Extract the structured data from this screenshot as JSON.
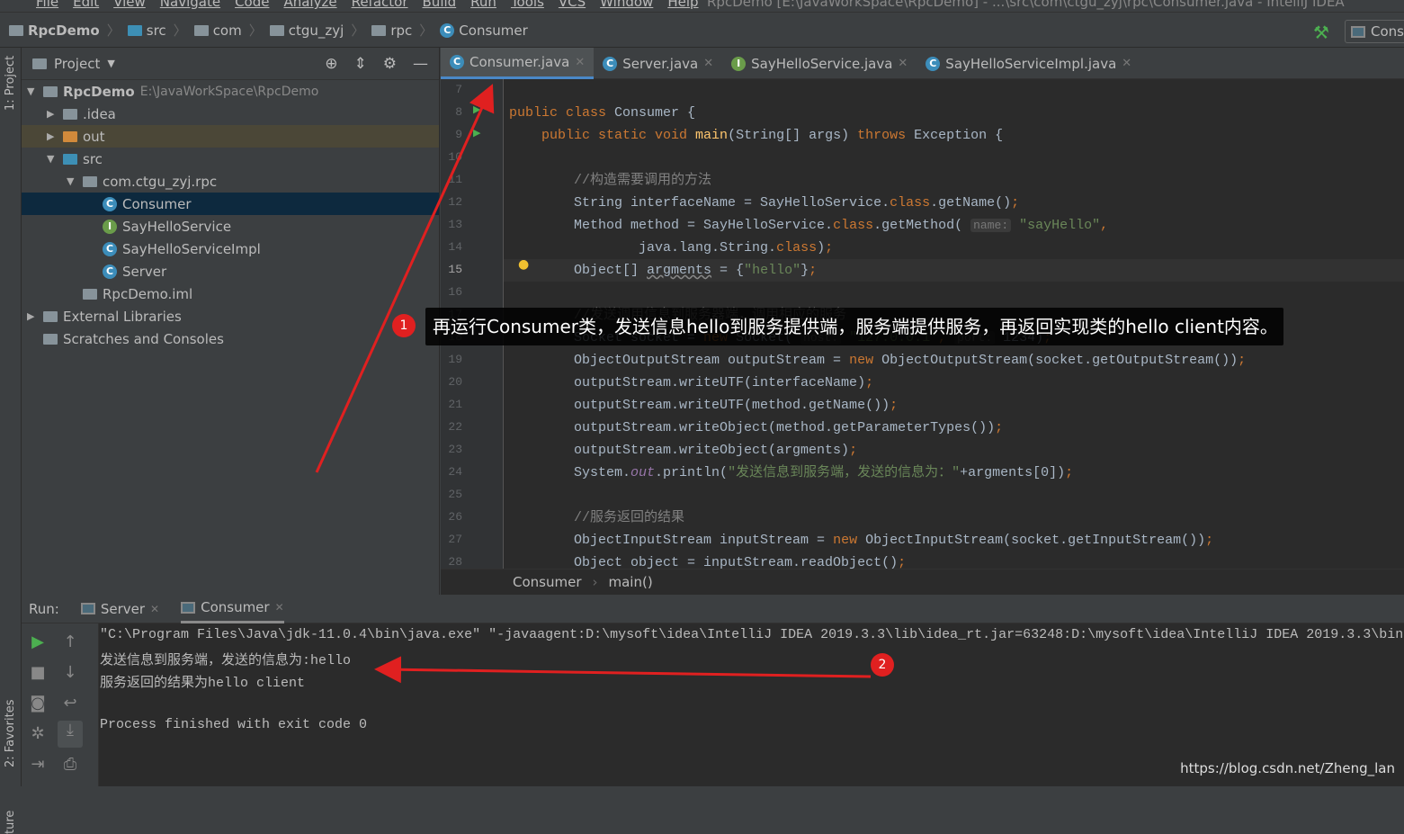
{
  "menubar": {
    "items": [
      "File",
      "Edit",
      "View",
      "Navigate",
      "Code",
      "Analyze",
      "Refactor",
      "Build",
      "Run",
      "Tools",
      "VCS",
      "Window",
      "Help"
    ],
    "title": "RpcDemo [E:\\JavaWorkSpace\\RpcDemo] - ...\\src\\com\\ctgu_zyj\\rpc\\Consumer.java - IntelliJ IDEA"
  },
  "navbar": {
    "crumbs": [
      "RpcDemo",
      "src",
      "com",
      "ctgu_zyj",
      "rpc",
      "Consumer"
    ],
    "run_config": "Cons"
  },
  "sidestrip": {
    "project": "1: Project",
    "favorites": "2: Favorites",
    "structure": "ture"
  },
  "project": {
    "title": "Project",
    "tree": [
      {
        "label": "RpcDemo",
        "extra": "E:\\JavaWorkSpace\\RpcDemo",
        "icon": "module-folder-icon",
        "level": 0,
        "arrow": "▼"
      },
      {
        "label": ".idea",
        "icon": "folder-icon",
        "level": 1,
        "arrow": "▶"
      },
      {
        "label": "out",
        "icon": "folder-orange-icon",
        "level": 1,
        "arrow": "▶",
        "highlight": true
      },
      {
        "label": "src",
        "icon": "folder-blue-icon",
        "level": 1,
        "arrow": "▼"
      },
      {
        "label": "com.ctgu_zyj.rpc",
        "icon": "package-icon",
        "level": 2,
        "arrow": "▼"
      },
      {
        "label": "Consumer",
        "icon": "class-icon",
        "level": 3,
        "selected": true
      },
      {
        "label": "SayHelloService",
        "icon": "interface-icon",
        "level": 3
      },
      {
        "label": "SayHelloServiceImpl",
        "icon": "class-icon",
        "level": 3
      },
      {
        "label": "Server",
        "icon": "class-icon",
        "level": 3
      },
      {
        "label": "RpcDemo.iml",
        "icon": "iml-file-icon",
        "level": 2
      },
      {
        "label": "External Libraries",
        "icon": "libraries-icon",
        "level": 0,
        "arrow": "▶"
      },
      {
        "label": "Scratches and Consoles",
        "icon": "scratches-icon",
        "level": 0
      }
    ]
  },
  "tabs": [
    {
      "label": "Consumer.java",
      "icon": "C",
      "active": true
    },
    {
      "label": "Server.java",
      "icon": "C"
    },
    {
      "label": "SayHelloService.java",
      "icon": "I"
    },
    {
      "label": "SayHelloServiceImpl.java",
      "icon": "C"
    }
  ],
  "editor": {
    "current_line": 15,
    "lines": [
      {
        "n": 7,
        "t": []
      },
      {
        "n": 8,
        "t": [
          [
            "k",
            "public class "
          ],
          [
            "",
            "Consumer {"
          ]
        ]
      },
      {
        "n": 9,
        "t": [
          [
            "",
            "    "
          ],
          [
            "k",
            "public static void "
          ],
          [
            "m",
            "main"
          ],
          [
            "",
            "(String[] args) "
          ],
          [
            "k",
            "throws "
          ],
          [
            "",
            "Exception {"
          ]
        ]
      },
      {
        "n": 10,
        "t": []
      },
      {
        "n": 11,
        "t": [
          [
            "c",
            "        //构造需要调用的方法"
          ]
        ]
      },
      {
        "n": 12,
        "t": [
          [
            "",
            "        String interfaceName = SayHelloService."
          ],
          [
            "k",
            "class"
          ],
          [
            "",
            ".getName()"
          ],
          [
            "k",
            ";"
          ]
        ]
      },
      {
        "n": 13,
        "t": [
          [
            "",
            "        Method method = SayHelloService."
          ],
          [
            "k",
            "class"
          ],
          [
            "",
            ".getMethod( "
          ],
          [
            "h",
            "name:"
          ],
          [
            "s",
            " \"sayHello\""
          ],
          [
            "k",
            ","
          ]
        ]
      },
      {
        "n": 14,
        "t": [
          [
            "",
            "                java.lang.String."
          ],
          [
            "k",
            "class"
          ],
          [
            "",
            ")"
          ],
          [
            "k",
            ";"
          ]
        ]
      },
      {
        "n": 15,
        "t": [
          [
            "",
            "        Object[] "
          ],
          [
            "u",
            "argments"
          ],
          [
            "",
            " = {"
          ],
          [
            "s",
            "\"hello\""
          ],
          [
            "",
            "}"
          ],
          [
            "k",
            ";"
          ]
        ]
      },
      {
        "n": 16,
        "t": []
      },
      {
        "n": 17,
        "t": [
          [
            "c",
            "        //发送调用信息到服务器端，调用相应的服务"
          ]
        ]
      },
      {
        "n": 18,
        "t": [
          [
            "",
            "        Socket socket = "
          ],
          [
            "k",
            "new "
          ],
          [
            "",
            "Socket( "
          ],
          [
            "h",
            "host:"
          ],
          [
            "s",
            " \"127.0.0.1\""
          ],
          [
            "k",
            ", "
          ],
          [
            "h",
            "port:"
          ],
          [
            "",
            " 1234)"
          ],
          [
            "k",
            ";"
          ]
        ]
      },
      {
        "n": 19,
        "t": [
          [
            "",
            "        ObjectOutputStream outputStream = "
          ],
          [
            "k",
            "new "
          ],
          [
            "",
            "ObjectOutputStream(socket.getOutputStream())"
          ],
          [
            "k",
            ";"
          ]
        ]
      },
      {
        "n": 20,
        "t": [
          [
            "",
            "        outputStream.writeUTF(interfaceName)"
          ],
          [
            "k",
            ";"
          ]
        ]
      },
      {
        "n": 21,
        "t": [
          [
            "",
            "        outputStream.writeUTF(method.getName())"
          ],
          [
            "k",
            ";"
          ]
        ]
      },
      {
        "n": 22,
        "t": [
          [
            "",
            "        outputStream.writeObject(method.getParameterTypes())"
          ],
          [
            "k",
            ";"
          ]
        ]
      },
      {
        "n": 23,
        "t": [
          [
            "",
            "        outputStream.writeObject(argments)"
          ],
          [
            "k",
            ";"
          ]
        ]
      },
      {
        "n": 24,
        "t": [
          [
            "",
            "        System."
          ],
          [
            "n",
            "out"
          ],
          [
            "",
            ".println("
          ],
          [
            "s",
            "\"发送信息到服务端，发送的信息为：\""
          ],
          [
            "",
            "+argments[0])"
          ],
          [
            "k",
            ";"
          ]
        ]
      },
      {
        "n": 25,
        "t": []
      },
      {
        "n": 26,
        "t": [
          [
            "c",
            "        //服务返回的结果"
          ]
        ]
      },
      {
        "n": 27,
        "t": [
          [
            "",
            "        ObjectInputStream inputStream = "
          ],
          [
            "k",
            "new "
          ],
          [
            "",
            "ObjectInputStream(socket.getInputStream())"
          ],
          [
            "k",
            ";"
          ]
        ]
      },
      {
        "n": 28,
        "t": [
          [
            "",
            "        Object object = inputStream.readObject()"
          ],
          [
            "k",
            ";"
          ]
        ]
      }
    ]
  },
  "editor_breadcrumb": [
    "Consumer",
    "main()"
  ],
  "run": {
    "label": "Run:",
    "tabs": [
      {
        "label": "Server"
      },
      {
        "label": "Consumer",
        "active": true
      }
    ],
    "output": [
      "\"C:\\Program Files\\Java\\jdk-11.0.4\\bin\\java.exe\" \"-javaagent:D:\\mysoft\\idea\\IntelliJ IDEA 2019.3.3\\lib\\idea_rt.jar=63248:D:\\mysoft\\idea\\IntelliJ IDEA 2019.3.3\\bin",
      "发送信息到服务端，发送的信息为:hello",
      "服务返回的结果为hello client",
      "",
      "Process finished with exit code 0"
    ]
  },
  "annotation": {
    "badge1": "1",
    "badge2": "2",
    "text": "再运行Consumer类，发送信息hello到服务提供端，服务端提供服务，再返回实现类的hello client内容。",
    "color": "#e02020"
  },
  "watermark": "https://blog.csdn.net/Zheng_lan"
}
